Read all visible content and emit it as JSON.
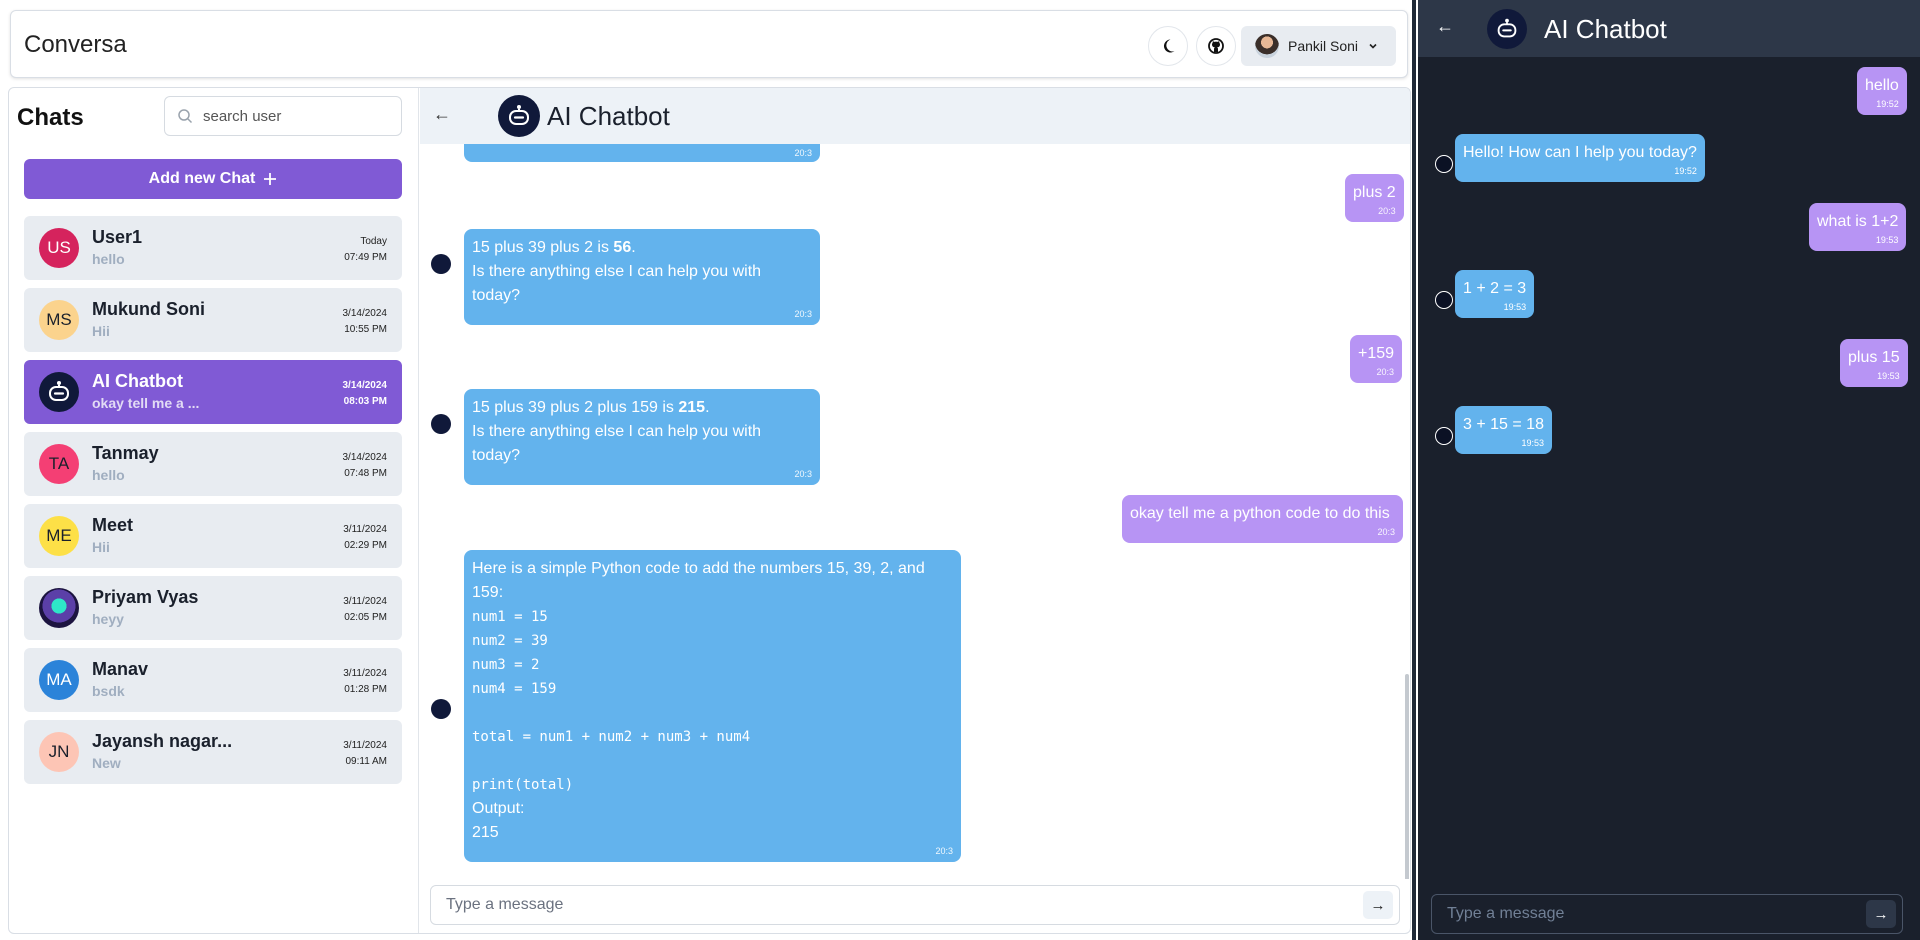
{
  "app": {
    "brand": "Conversa",
    "user_name": "Pankil Soni"
  },
  "sidebar": {
    "title": "Chats",
    "search_placeholder": "search user",
    "add_chat_label": "Add new Chat",
    "chats": [
      {
        "initials": "US",
        "name": "User1",
        "last_message": "hello",
        "date": "Today",
        "time": "07:49 PM",
        "avatar_color": "#d5235d",
        "initials_color": "#ffffff"
      },
      {
        "initials": "MS",
        "name": "Mukund Soni",
        "last_message": "Hii",
        "date": "3/14/2024",
        "time": "10:55 PM",
        "avatar_color": "#fbd38d",
        "initials_color": "#1a202c"
      },
      {
        "initials": "",
        "name": "AI Chatbot",
        "last_message": "okay tell me a ...",
        "date": "3/14/2024",
        "time": "08:03 PM",
        "avatar_color": "#10193a",
        "initials_color": "#ffffff"
      },
      {
        "initials": "TA",
        "name": "Tanmay",
        "last_message": "hello",
        "date": "3/14/2024",
        "time": "07:48 PM",
        "avatar_color": "#f43f74",
        "initials_color": "#1a202c"
      },
      {
        "initials": "ME",
        "name": "Meet",
        "last_message": "Hii",
        "date": "3/11/2024",
        "time": "02:29 PM",
        "avatar_color": "#fde047",
        "initials_color": "#1a202c"
      },
      {
        "initials": "",
        "name": "Priyam Vyas",
        "last_message": "heyy",
        "date": "3/11/2024",
        "time": "02:05 PM",
        "avatar_color": "#5b3fa8",
        "initials_color": "#ffffff"
      },
      {
        "initials": "MA",
        "name": "Manav",
        "last_message": "bsdk",
        "date": "3/11/2024",
        "time": "01:28 PM",
        "avatar_color": "#2b83d9",
        "initials_color": "#ffffff"
      },
      {
        "initials": "JN",
        "name": "Jayansh nagar...",
        "last_message": "New",
        "date": "3/11/2024",
        "time": "09:11 AM",
        "avatar_color": "#fdc5b5",
        "initials_color": "#1a202c"
      }
    ]
  },
  "chat": {
    "title": "AI Chatbot",
    "input_placeholder": "Type a message",
    "messages": [
      {
        "text_a": "",
        "ts": "20:3"
      },
      {
        "text_a": "plus 2",
        "ts": "20:3"
      },
      {
        "line1_a": "15 plus 39 plus 2 is ",
        "line1_b": "56",
        "line1_c": ".",
        "line2": "Is there anything else I can help you with today?",
        "ts": "20:3"
      },
      {
        "text_a": "+159",
        "ts": "20:3"
      },
      {
        "line1_a": "15 plus 39 plus 2 plus 159 is ",
        "line1_b": "215",
        "line1_c": ".",
        "line2": "Is there anything else I can help you with today?",
        "ts": "20:3"
      },
      {
        "text_a": "okay tell me a python code to do this",
        "ts": "20:3"
      },
      {
        "intro": "Here is a simple Python code to add the numbers 15, 39, 2, and 159:",
        "code1": "num1 = 15",
        "code2": "num2 = 39",
        "code3": "num3 = 2",
        "code4": "num4 = 159",
        "code5": "total = num1 + num2 + num3 + num4",
        "code6": "print(total)",
        "out_label": "Output:",
        "out_value": "215",
        "ts": "20:3"
      }
    ]
  },
  "dark": {
    "title": "AI Chatbot",
    "input_placeholder": "Type a message",
    "messages": [
      {
        "text": "hello",
        "ts": "19:52"
      },
      {
        "text": "Hello! How can I help you today?",
        "ts": "19:52"
      },
      {
        "text": "what is 1+2",
        "ts": "19:53"
      },
      {
        "text": "1 + 2 = 3",
        "ts": "19:53"
      },
      {
        "text": "plus 15",
        "ts": "19:53"
      },
      {
        "text": "3 + 15 = 18",
        "ts": "19:53"
      }
    ]
  }
}
